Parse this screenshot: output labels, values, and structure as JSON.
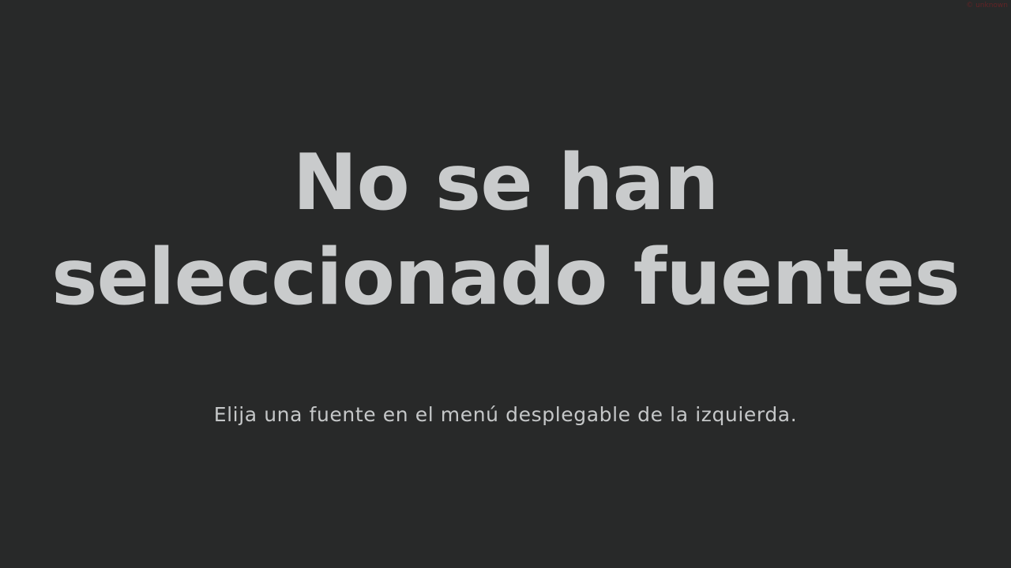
{
  "empty_state": {
    "title": "No se han seleccionado fuentes",
    "message": "Elija una fuente en el menú desplegable de la izquierda."
  },
  "corner_mark": {
    "text": "© unknown"
  },
  "colors": {
    "background": "#282929",
    "title_text": "#c9cbcc",
    "message_text": "#c5c7c8",
    "corner_mark": "#6b2326"
  }
}
